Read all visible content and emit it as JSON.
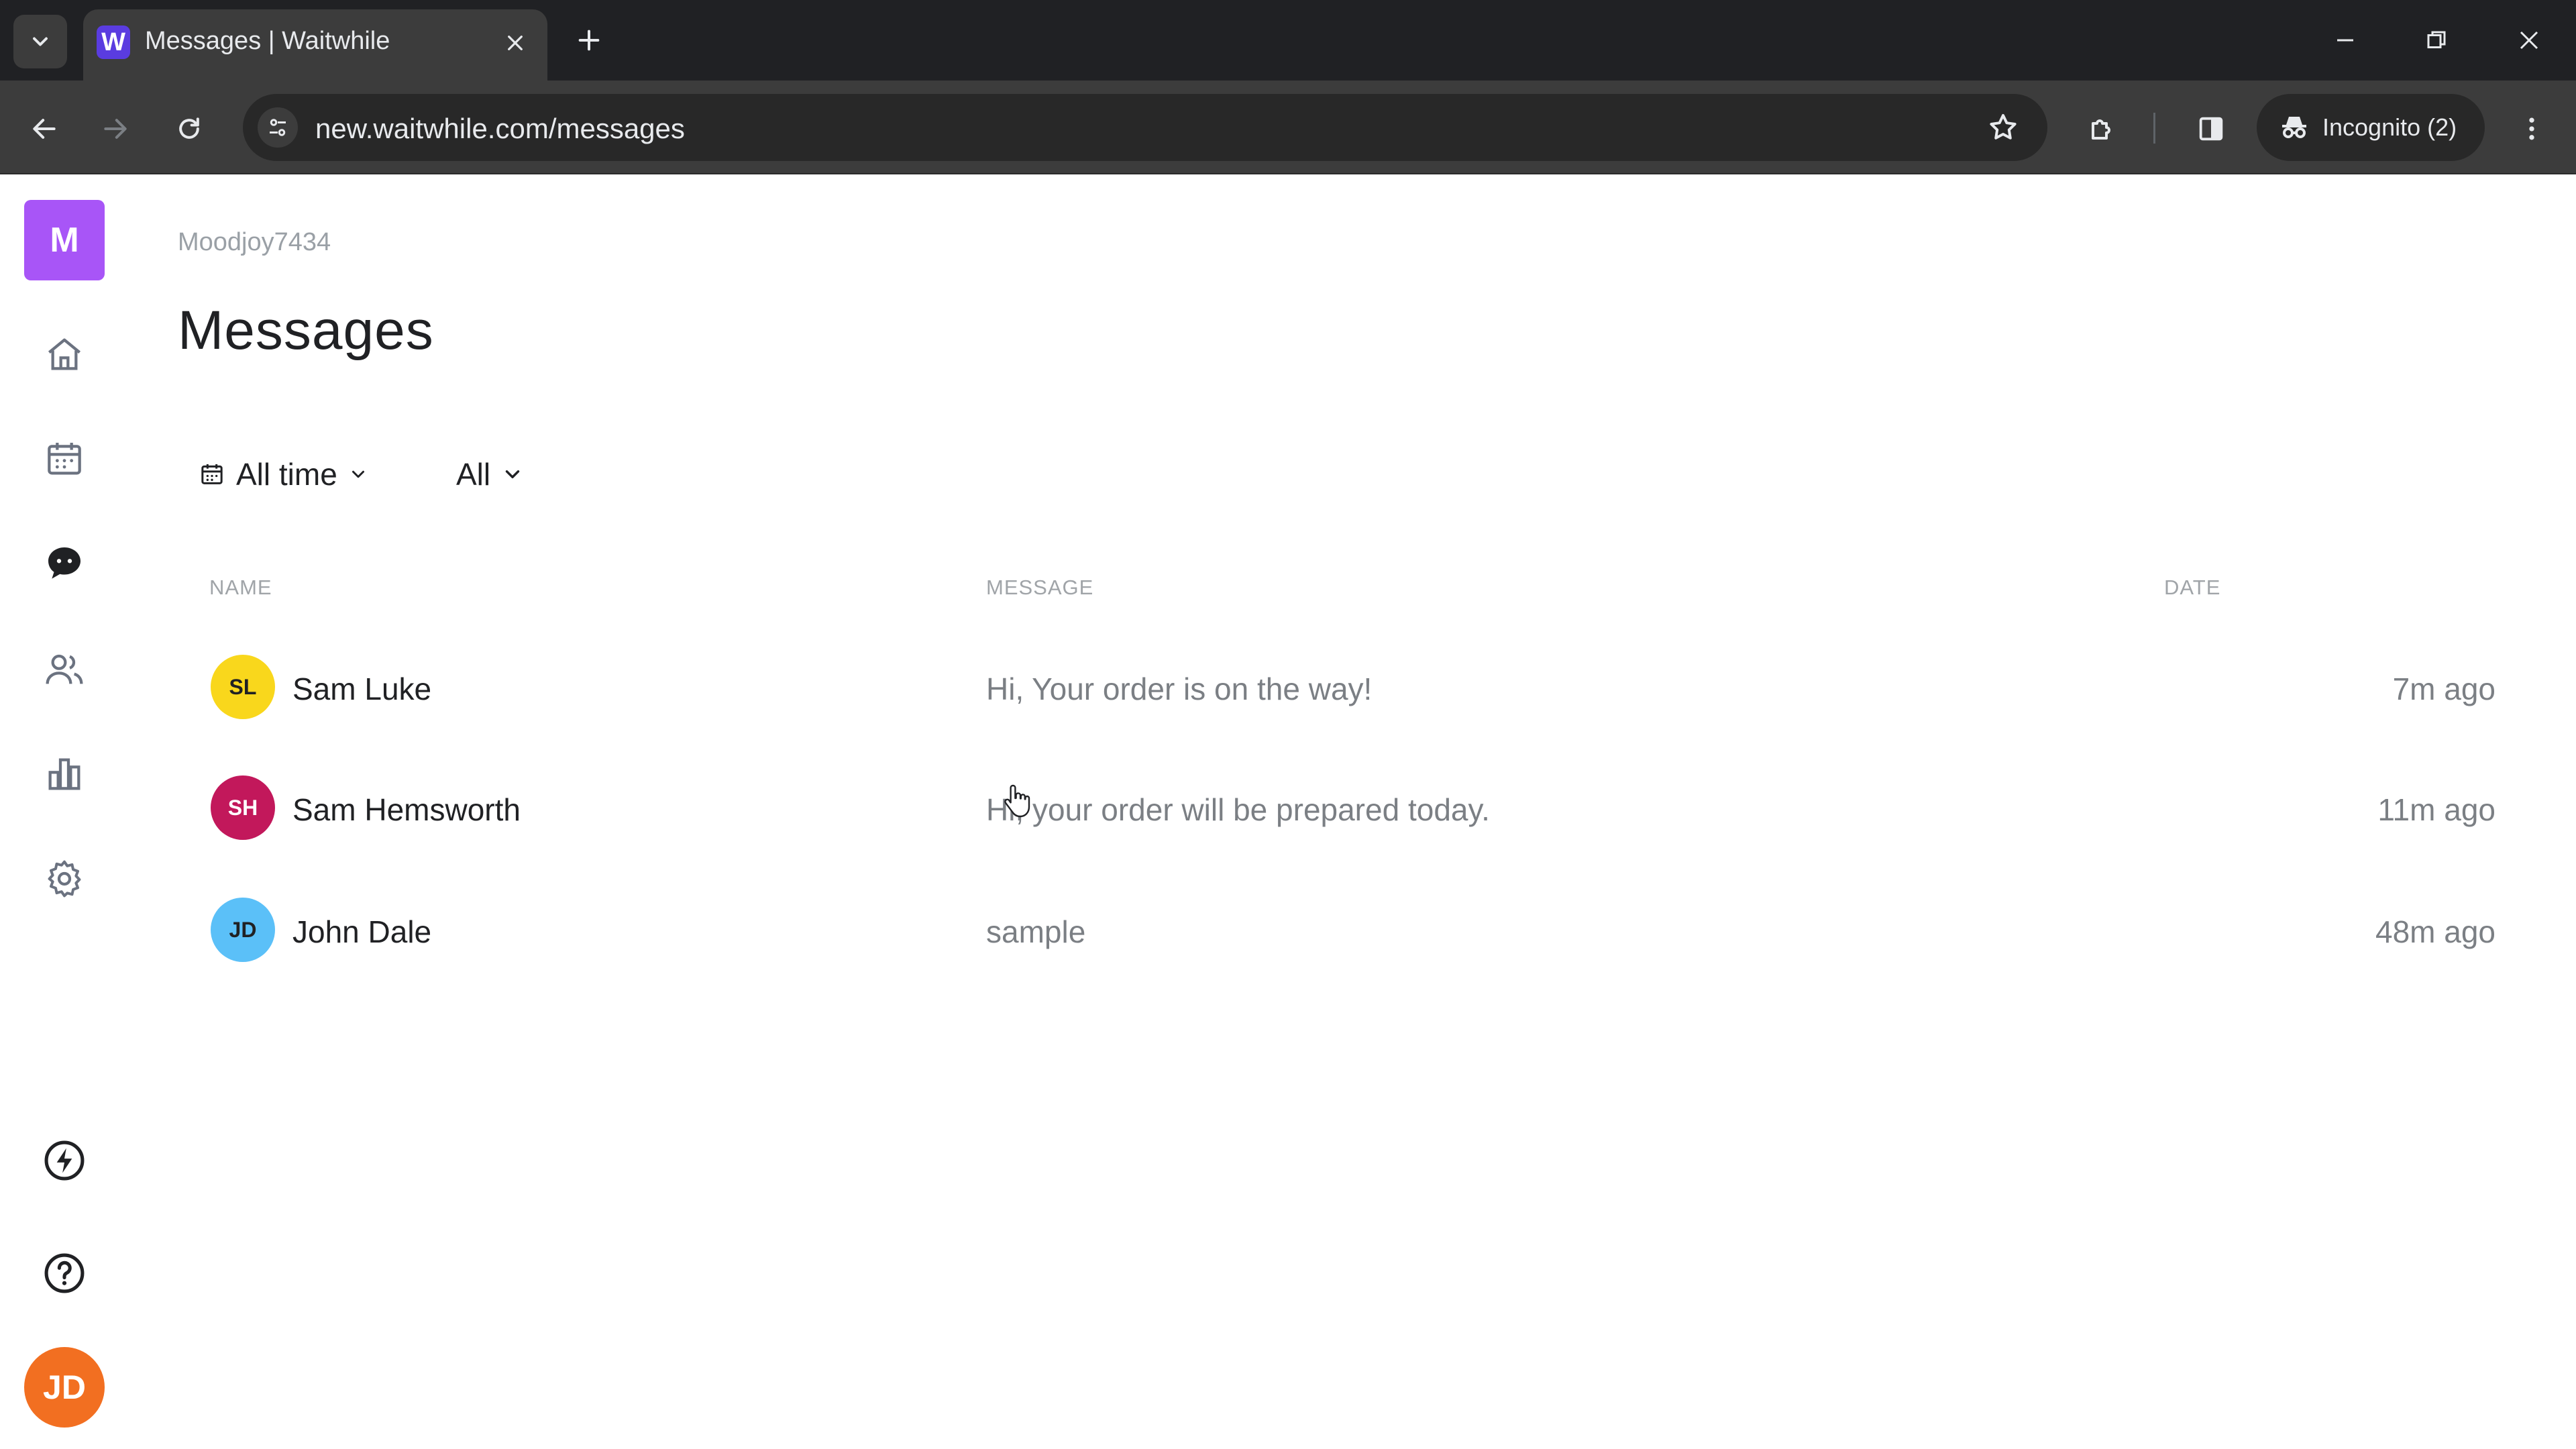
{
  "browser": {
    "tab_title": "Messages | Waitwhile",
    "tab_favicon_letter": "W",
    "url": "new.waitwhile.com/messages",
    "incognito_label": "Incognito (2)"
  },
  "sidebar": {
    "brand_letter": "M",
    "nav": [
      {
        "name": "home",
        "icon": "home-icon"
      },
      {
        "name": "calendar",
        "icon": "calendar-icon"
      },
      {
        "name": "messages",
        "icon": "chat-bubble-icon",
        "active": true
      },
      {
        "name": "customers",
        "icon": "users-icon"
      },
      {
        "name": "analytics",
        "icon": "bar-chart-icon"
      },
      {
        "name": "settings",
        "icon": "gear-icon"
      }
    ],
    "bottom": [
      {
        "name": "whats-new",
        "icon": "lightning-icon"
      },
      {
        "name": "help",
        "icon": "help-circle-icon"
      }
    ],
    "user_initials": "JD"
  },
  "main": {
    "account": "Moodjoy7434",
    "title": "Messages",
    "filters": {
      "time": "All time",
      "type": "All"
    },
    "columns": {
      "name": "NAME",
      "message": "MESSAGE",
      "date": "DATE"
    },
    "rows": [
      {
        "initials": "SL",
        "name": "Sam Luke",
        "message": "Hi, Your order is on the way!",
        "date": "7m ago"
      },
      {
        "initials": "SH",
        "name": "Sam Hemsworth",
        "message": "Hi, your order will be prepared today.",
        "date": "11m ago"
      },
      {
        "initials": "JD",
        "name": "John Dale",
        "message": "sample",
        "date": "48m ago"
      }
    ]
  },
  "colors": {
    "brand": "#a855f7",
    "avatar_sl": "#f9d71c",
    "avatar_sh": "#c2185b",
    "avatar_jd": "#5bc0f8",
    "user_avatar": "#f26f21"
  }
}
